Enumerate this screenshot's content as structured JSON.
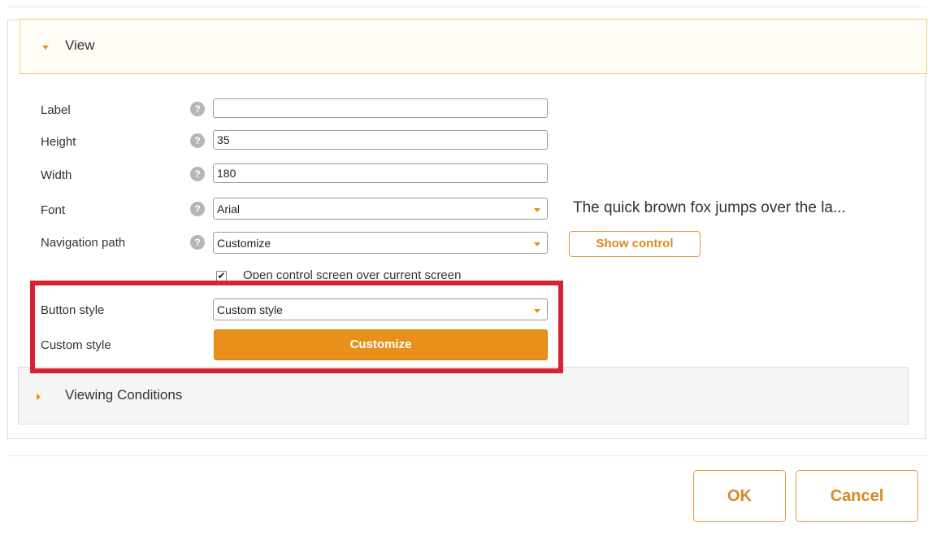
{
  "view_section": {
    "title": "View"
  },
  "fields": {
    "label": {
      "label": "Label",
      "value": ""
    },
    "height": {
      "label": "Height",
      "value": "35"
    },
    "width": {
      "label": "Width",
      "value": "180"
    },
    "font": {
      "label": "Font",
      "value": "Arial"
    },
    "navigation_path": {
      "label": "Navigation path",
      "value": "Customize"
    }
  },
  "help_icon": "?",
  "font_preview": "The quick brown fox jumps over the la...",
  "show_control_label": "Show control",
  "open_over_screen": {
    "checked": true,
    "check_glyph": "✔",
    "label": "Open control screen over current screen"
  },
  "button_style": {
    "label": "Button style",
    "value": "Custom style"
  },
  "custom_style": {
    "label": "Custom style",
    "button_label": "Customize"
  },
  "viewing_conditions": {
    "title": "Viewing Conditions"
  },
  "footer": {
    "ok_label": "OK",
    "cancel_label": "Cancel"
  },
  "colors": {
    "accent": "#e8901b",
    "highlight": "#d7222f",
    "header_border": "#f3d06b"
  }
}
